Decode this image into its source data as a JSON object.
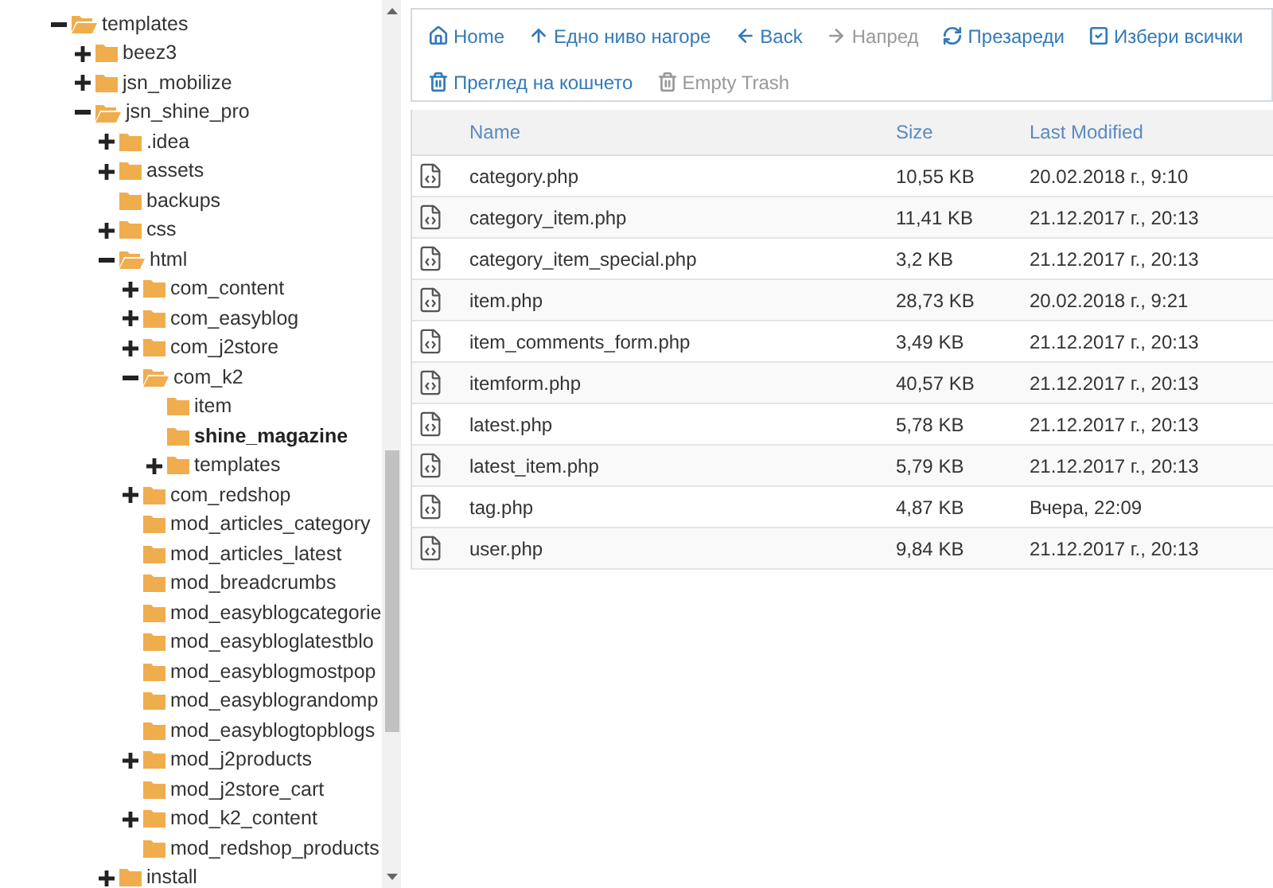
{
  "tree": [
    {
      "label": "templates",
      "kind": "expanded",
      "selected": false,
      "children": [
        {
          "label": "beez3",
          "kind": "collapsed",
          "selected": false
        },
        {
          "label": "jsn_mobilize",
          "kind": "collapsed",
          "selected": false
        },
        {
          "label": "jsn_shine_pro",
          "kind": "expanded",
          "selected": false,
          "children": [
            {
              "label": ".idea",
              "kind": "collapsed",
              "selected": false
            },
            {
              "label": "assets",
              "kind": "collapsed",
              "selected": false
            },
            {
              "label": "backups",
              "kind": "empty",
              "selected": false
            },
            {
              "label": "css",
              "kind": "collapsed",
              "selected": false
            },
            {
              "label": "html",
              "kind": "expanded",
              "selected": false,
              "children": [
                {
                  "label": "com_content",
                  "kind": "collapsed",
                  "selected": false
                },
                {
                  "label": "com_easyblog",
                  "kind": "collapsed",
                  "selected": false
                },
                {
                  "label": "com_j2store",
                  "kind": "collapsed",
                  "selected": false
                },
                {
                  "label": "com_k2",
                  "kind": "expanded",
                  "selected": false,
                  "children": [
                    {
                      "label": "item",
                      "kind": "empty",
                      "selected": false
                    },
                    {
                      "label": "shine_magazine",
                      "kind": "empty",
                      "selected": true
                    },
                    {
                      "label": "templates",
                      "kind": "collapsed",
                      "selected": false
                    }
                  ]
                },
                {
                  "label": "com_redshop",
                  "kind": "collapsed",
                  "selected": false
                },
                {
                  "label": "mod_articles_category",
                  "kind": "empty",
                  "selected": false
                },
                {
                  "label": "mod_articles_latest",
                  "kind": "empty",
                  "selected": false
                },
                {
                  "label": "mod_breadcrumbs",
                  "kind": "empty",
                  "selected": false
                },
                {
                  "label": "mod_easyblogcategorie",
                  "kind": "empty",
                  "selected": false
                },
                {
                  "label": "mod_easybloglatestblo",
                  "kind": "empty",
                  "selected": false
                },
                {
                  "label": "mod_easyblogmostpop",
                  "kind": "empty",
                  "selected": false
                },
                {
                  "label": "mod_easyblograndomp",
                  "kind": "empty",
                  "selected": false
                },
                {
                  "label": "mod_easyblogtopblogs",
                  "kind": "empty",
                  "selected": false
                },
                {
                  "label": "mod_j2products",
                  "kind": "collapsed",
                  "selected": false
                },
                {
                  "label": "mod_j2store_cart",
                  "kind": "empty",
                  "selected": false
                },
                {
                  "label": "mod_k2_content",
                  "kind": "collapsed",
                  "selected": false
                },
                {
                  "label": "mod_redshop_products",
                  "kind": "empty",
                  "selected": false
                }
              ]
            },
            {
              "label": "install",
              "kind": "collapsed",
              "selected": false
            }
          ]
        }
      ]
    }
  ],
  "toolbar": [
    {
      "label": "Home",
      "kind": "home",
      "disabled": false
    },
    {
      "label": "Едно ниво нагоре",
      "kind": "up",
      "disabled": false
    },
    {
      "label": "Back",
      "kind": "back",
      "disabled": false
    },
    {
      "label": "Напред",
      "kind": "forward",
      "disabled": true
    },
    {
      "label": "Презареди",
      "kind": "reload",
      "disabled": false
    },
    {
      "label": "Избери всички",
      "kind": "select-all",
      "disabled": false
    },
    {
      "label": "Преглед на кошчето",
      "kind": "trash",
      "disabled": false
    },
    {
      "label": "Empty Trash",
      "kind": "trash",
      "disabled": true
    }
  ],
  "table": {
    "columns": [
      "Name",
      "Size",
      "Last Modified"
    ],
    "rows": [
      [
        "category.php",
        "10,55 KB",
        "20.02.2018 г., 9:10"
      ],
      [
        "category_item.php",
        "11,41 KB",
        "21.12.2017 г., 20:13"
      ],
      [
        "category_item_special.php",
        "3,2 KB",
        "21.12.2017 г., 20:13"
      ],
      [
        "item.php",
        "28,73 KB",
        "20.02.2018 г., 9:21"
      ],
      [
        "item_comments_form.php",
        "3,49 KB",
        "21.12.2017 г., 20:13"
      ],
      [
        "itemform.php",
        "40,57 KB",
        "21.12.2017 г., 20:13"
      ],
      [
        "latest.php",
        "5,78 KB",
        "21.12.2017 г., 20:13"
      ],
      [
        "latest_item.php",
        "5,79 KB",
        "21.12.2017 г., 20:13"
      ],
      [
        "tag.php",
        "4,87 KB",
        "Вчера, 22:09"
      ],
      [
        "user.php",
        "9,84 KB",
        "21.12.2017 г., 20:13"
      ]
    ]
  }
}
